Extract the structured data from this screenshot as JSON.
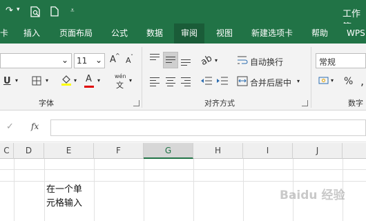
{
  "window": {
    "title": "工作簿"
  },
  "quick_access": {
    "redo_icon": "redo-icon",
    "print_preview_icon": "print-preview-icon",
    "new_icon": "new-document-icon",
    "customize_icon": "chevron-down-icon"
  },
  "tabs": [
    {
      "label": "卡"
    },
    {
      "label": "插入"
    },
    {
      "label": "页面布局"
    },
    {
      "label": "公式"
    },
    {
      "label": "数据"
    },
    {
      "label": "审阅",
      "active": true
    },
    {
      "label": "视图"
    },
    {
      "label": "新建选项卡"
    },
    {
      "label": "帮助"
    },
    {
      "label": "WPS"
    }
  ],
  "ribbon": {
    "font": {
      "size": "11",
      "grow_label": "A",
      "shrink_label": "A",
      "underline_label": "U",
      "font_color_label": "A",
      "phonetic_top": "wén",
      "phonetic_bottom": "文",
      "group_label": "字体"
    },
    "alignment": {
      "wrap_text": "自动换行",
      "merge_center": "合并后居中",
      "group_label": "对齐方式"
    },
    "number": {
      "format": "常规",
      "percent": "%",
      "comma": ",",
      "group_label": "数字"
    },
    "colors": {
      "fill": "#ffff00",
      "font": "#e00000",
      "accent": "#217346"
    }
  },
  "formula_bar": {
    "cancel": "✓",
    "fx": "fx",
    "value": ""
  },
  "sheet": {
    "columns": [
      "C",
      "D",
      "E",
      "F",
      "G",
      "H",
      "I",
      "J"
    ],
    "selected_column": "G",
    "cell_text_line1": "在一个单",
    "cell_text_line2": "元格输入"
  },
  "watermark": {
    "text": "Baidu 经验"
  }
}
